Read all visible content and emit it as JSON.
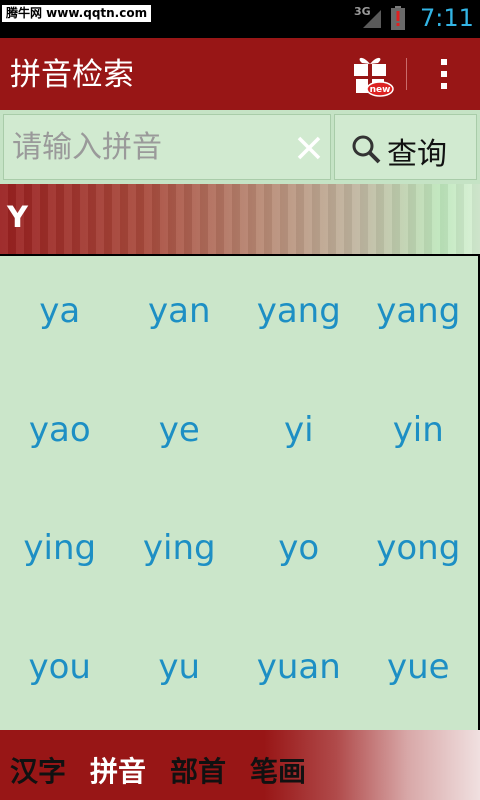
{
  "status_bar": {
    "watermark": "腾牛网 www.qqtn.com",
    "network_label": "3G",
    "time": "7:11"
  },
  "action_bar": {
    "title": "拼音检索",
    "gift_icon": "gift-new-icon",
    "gift_badge": "new",
    "menu_icon": "overflow-menu-icon"
  },
  "search": {
    "placeholder": "请输入拼音",
    "value": "",
    "clear_icon": "close-icon",
    "button_icon": "search-icon",
    "button_label": "查询"
  },
  "section": {
    "letter": "Y"
  },
  "syllables": [
    "ya",
    "yan",
    "yang",
    "yang",
    "yao",
    "ye",
    "yi",
    "yin",
    "ying",
    "ying",
    "yo",
    "yong",
    "you",
    "yu",
    "yuan",
    "yue"
  ],
  "tabs": [
    {
      "label": "汉字",
      "active": false
    },
    {
      "label": "拼音",
      "active": true
    },
    {
      "label": "部首",
      "active": false
    },
    {
      "label": "笔画",
      "active": false
    }
  ],
  "colors": {
    "brand_red": "#981616",
    "grid_bg": "#cbe6ca",
    "syllable_text": "#1d8fc4",
    "clock": "#33b5e5"
  }
}
